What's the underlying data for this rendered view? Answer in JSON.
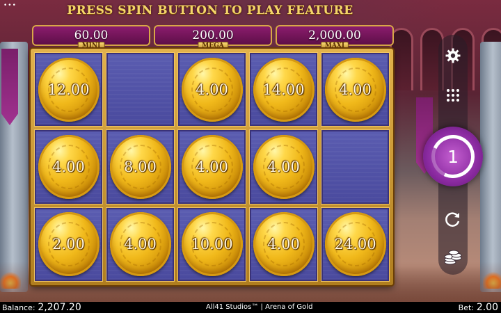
{
  "header": {
    "title": "PRESS SPIN BUTTON TO PLAY FEATURE"
  },
  "jackpots": [
    {
      "value": "60.00",
      "label": "MINI"
    },
    {
      "value": "200.00",
      "label": "MEGA"
    },
    {
      "value": "2,000.00",
      "label": "MAXI"
    }
  ],
  "grid": {
    "rows": [
      [
        "12.00",
        "",
        "4.00",
        "14.00",
        "4.00"
      ],
      [
        "4.00",
        "8.00",
        "4.00",
        "4.00",
        ""
      ],
      [
        "2.00",
        "4.00",
        "10.00",
        "4.00",
        "24.00"
      ]
    ]
  },
  "controls": {
    "spins_remaining": "1",
    "icons": [
      "gear-icon",
      "grid-menu-icon",
      "autoplay-icon",
      "coin-stack-icon"
    ]
  },
  "footer": {
    "balance_label": "Balance:",
    "balance_value": "2,207.20",
    "brand": "All41 Studios™ | Arena of Gold",
    "bet_label": "Bet:",
    "bet_value": "2.00"
  },
  "colors": {
    "coin_gold": "#f0b81a",
    "cell_blue": "#4a4a9e",
    "frame_gold": "#d8a747",
    "jackpot_purple": "#8b1c6d",
    "spin_purple": "#8a2aa0"
  }
}
